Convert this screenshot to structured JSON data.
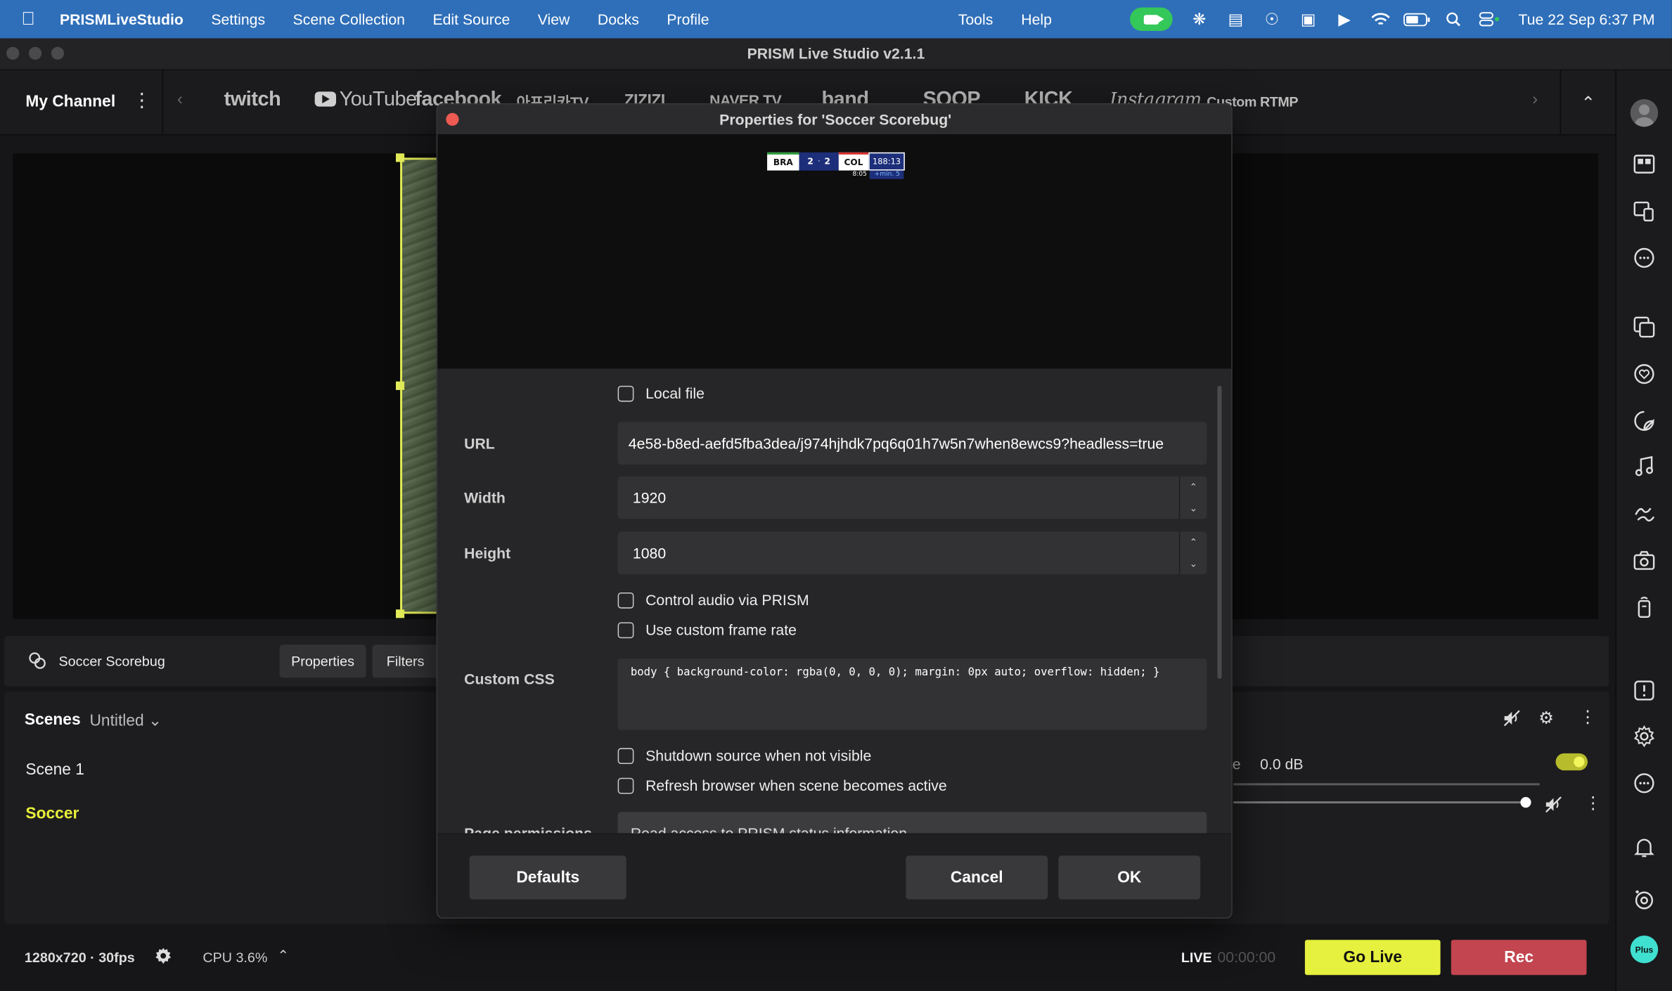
{
  "menubar": {
    "app_name": "PRISMLiveStudio",
    "items": [
      "Settings",
      "Scene Collection",
      "Edit Source",
      "View",
      "Docks",
      "Profile"
    ],
    "right_items": [
      "Tools",
      "Help"
    ],
    "datetime": "Tue 22 Sep  6:37 PM"
  },
  "window": {
    "title": "PRISM Live Studio v2.1.1"
  },
  "channel_bar": {
    "my_channel": "My Channel",
    "platforms": [
      "twitch",
      "YouTube",
      "facebook",
      "아프리카TV",
      "ZIZIZI",
      "NAVER TV",
      "band",
      "SOOP",
      "KICK",
      "Instagram",
      "Custom RTMP"
    ]
  },
  "source_bar": {
    "source_name": "Soccer Scorebug",
    "properties_label": "Properties",
    "filters_label": "Filters"
  },
  "scenes": {
    "title": "Scenes",
    "collection": "Untitled",
    "items": [
      {
        "label": "Scene 1",
        "active": false
      },
      {
        "label": "Soccer",
        "active": true
      }
    ]
  },
  "mixer": {
    "level": "0.0 dB",
    "partial_label": "e"
  },
  "status": {
    "resolution": "1280x720 · 30fps",
    "cpu": "CPU 3.6%",
    "live_label": "LIVE",
    "live_time": "00:00:00",
    "go_live": "Go Live",
    "rec": "Rec"
  },
  "dialog": {
    "title": "Properties for 'Soccer Scorebug'",
    "scorebug": {
      "team1": "BRA",
      "score1": "2",
      "score2": "2",
      "team2": "COL",
      "clock": "188:13",
      "sub_time": "8:05",
      "added": "+min. 5"
    },
    "local_file_label": "Local file",
    "url_label": "URL",
    "url_value": "4e58-b8ed-aefd5fba3dea/j974hjhdk7pq6q01h7w5n7when8ewcs9?headless=true",
    "width_label": "Width",
    "width_value": "1920",
    "height_label": "Height",
    "height_value": "1080",
    "control_audio_label": "Control audio via PRISM",
    "custom_fps_label": "Use custom frame rate",
    "css_label": "Custom CSS",
    "css_value": "body { background-color: rgba(0, 0, 0, 0); margin: 0px auto; overflow: hidden; }",
    "shutdown_label": "Shutdown source when not visible",
    "refresh_label": "Refresh browser when scene becomes active",
    "page_perm_label": "Page permissions",
    "page_perm_value": "Read access to PRISM status information",
    "defaults_label": "Defaults",
    "cancel_label": "Cancel",
    "ok_label": "OK"
  },
  "colors": {
    "menubar": "#2f6fb9",
    "accent_yellow": "#e6f03e",
    "rec_red": "#c2454f",
    "active_scene": "#e8ef3a"
  }
}
